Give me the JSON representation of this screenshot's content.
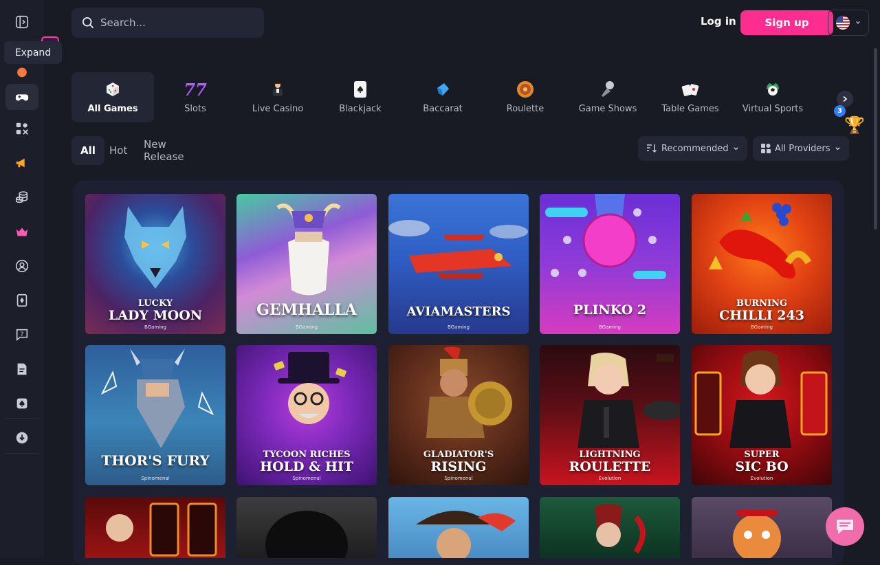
{
  "sidebar": {
    "tooltip": "Expand",
    "items": [
      {
        "name": "expand-sidebar-icon"
      },
      {
        "name": "promo-wheel-icon"
      },
      {
        "name": "gamepad-icon"
      },
      {
        "name": "categories-icon"
      },
      {
        "name": "megaphone-icon"
      },
      {
        "name": "coins-icon"
      },
      {
        "name": "crown-icon"
      },
      {
        "name": "user-settings-icon"
      },
      {
        "name": "cards-icon"
      },
      {
        "name": "help-icon"
      },
      {
        "name": "document-icon"
      },
      {
        "name": "spade-icon"
      },
      {
        "name": "download-icon"
      }
    ]
  },
  "header": {
    "search_placeholder": "Search...",
    "login_label": "Log in",
    "signup_label": "Sign up",
    "language": "flag-us-icon"
  },
  "categories": [
    {
      "label": "All Games",
      "icon": "dice-icon",
      "active": true
    },
    {
      "label": "Slots",
      "icon": "seven-icon"
    },
    {
      "label": "Live Casino",
      "icon": "dealer-icon"
    },
    {
      "label": "Blackjack",
      "icon": "card-icon"
    },
    {
      "label": "Baccarat",
      "icon": "baccarat-icon"
    },
    {
      "label": "Roulette",
      "icon": "roulette-icon"
    },
    {
      "label": "Game Shows",
      "icon": "microphone-icon"
    },
    {
      "label": "Table Games",
      "icon": "table-cards-icon"
    },
    {
      "label": "Virtual Sports",
      "icon": "football-icon"
    }
  ],
  "badge_count": "3",
  "filters": {
    "tabs": [
      "All",
      "Hot",
      "New Release"
    ],
    "sort_label": "Recommended",
    "providers_label": "All Providers"
  },
  "games": [
    {
      "line1": "LUCKY",
      "line2": "LADY MOON",
      "provider": "BGaming"
    },
    {
      "line1": "",
      "line2": "GEMHALLA",
      "provider": "BGaming"
    },
    {
      "line1": "",
      "line2": "AVIAMASTERS",
      "provider": "BGaming"
    },
    {
      "line1": "",
      "line2": "PLINKO 2",
      "provider": "BGaming"
    },
    {
      "line1": "BURNING",
      "line2": "CHILLI 243",
      "provider": "BGaming"
    },
    {
      "line1": "",
      "line2": "THOR'S FURY",
      "provider": "Spinomenal"
    },
    {
      "line1": "TYCOON RICHES",
      "line2": "HOLD & HIT",
      "provider": "Spinomenal"
    },
    {
      "line1": "GLADIATOR'S",
      "line2": "RISING",
      "provider": "Spinomenal"
    },
    {
      "line1": "LIGHTNING",
      "line2": "ROULETTE",
      "provider": "Evolution"
    },
    {
      "line1": "SUPER",
      "line2": "SIC BO",
      "provider": "Evolution"
    }
  ],
  "colors": {
    "accent": "#ff2d8f",
    "bg": "#181a24",
    "panel": "#232634"
  }
}
